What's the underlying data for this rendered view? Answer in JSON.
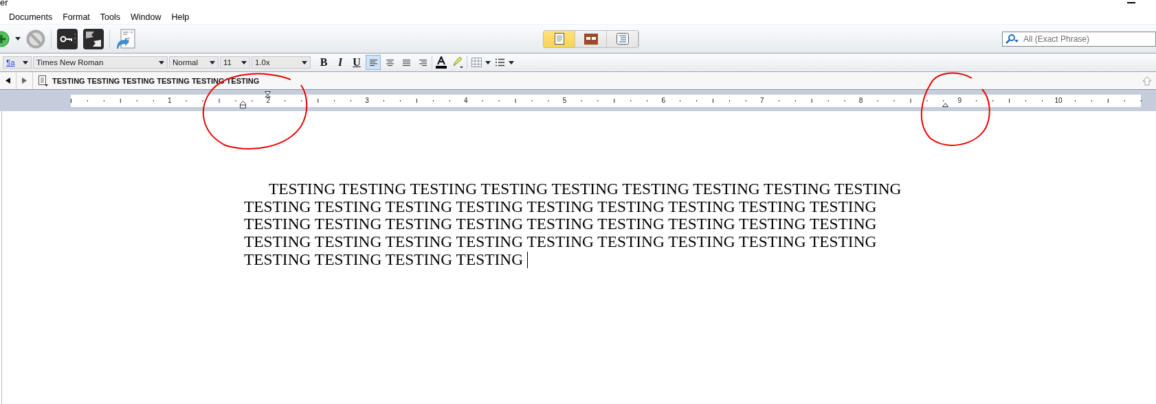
{
  "window": {
    "title": "er"
  },
  "menu": [
    "Documents",
    "Format",
    "Tools",
    "Window",
    "Help"
  ],
  "view_modes": [
    {
      "kind": "page",
      "selected": true
    },
    {
      "kind": "corkboard",
      "selected": false
    },
    {
      "kind": "outline",
      "selected": false
    }
  ],
  "search": {
    "placeholder": "All (Exact Phrase)"
  },
  "format_bar": {
    "style_button": "¶a",
    "font": "Times New Roman",
    "style": "Normal",
    "size": "11",
    "spacing": "1.0x",
    "bold": "B",
    "italic": "I",
    "underline": "U",
    "alignments": [
      {
        "kind": "left",
        "selected": true
      },
      {
        "kind": "center",
        "selected": false
      },
      {
        "kind": "justify",
        "selected": false
      },
      {
        "kind": "right",
        "selected": false
      }
    ]
  },
  "header": {
    "title": "TESTING TESTING TESTING TESTING TESTING TESTING"
  },
  "ruler": {
    "labels": [
      "1",
      "2",
      "3",
      "4",
      "5",
      "6",
      "7",
      "8",
      "9",
      "10"
    ]
  },
  "document": {
    "paragraph": "TESTING TESTING TESTING TESTING TESTING TESTING TESTING TESTING TESTING TESTING TESTING TESTING TESTING TESTING TESTING TESTING TESTING TESTING TESTING TESTING TESTING TESTING TESTING TESTING TESTING TESTING TESTING TESTING TESTING TESTING TESTING TESTING TESTING TESTING TESTING TESTING TESTING TESTING TESTING TESTING"
  }
}
